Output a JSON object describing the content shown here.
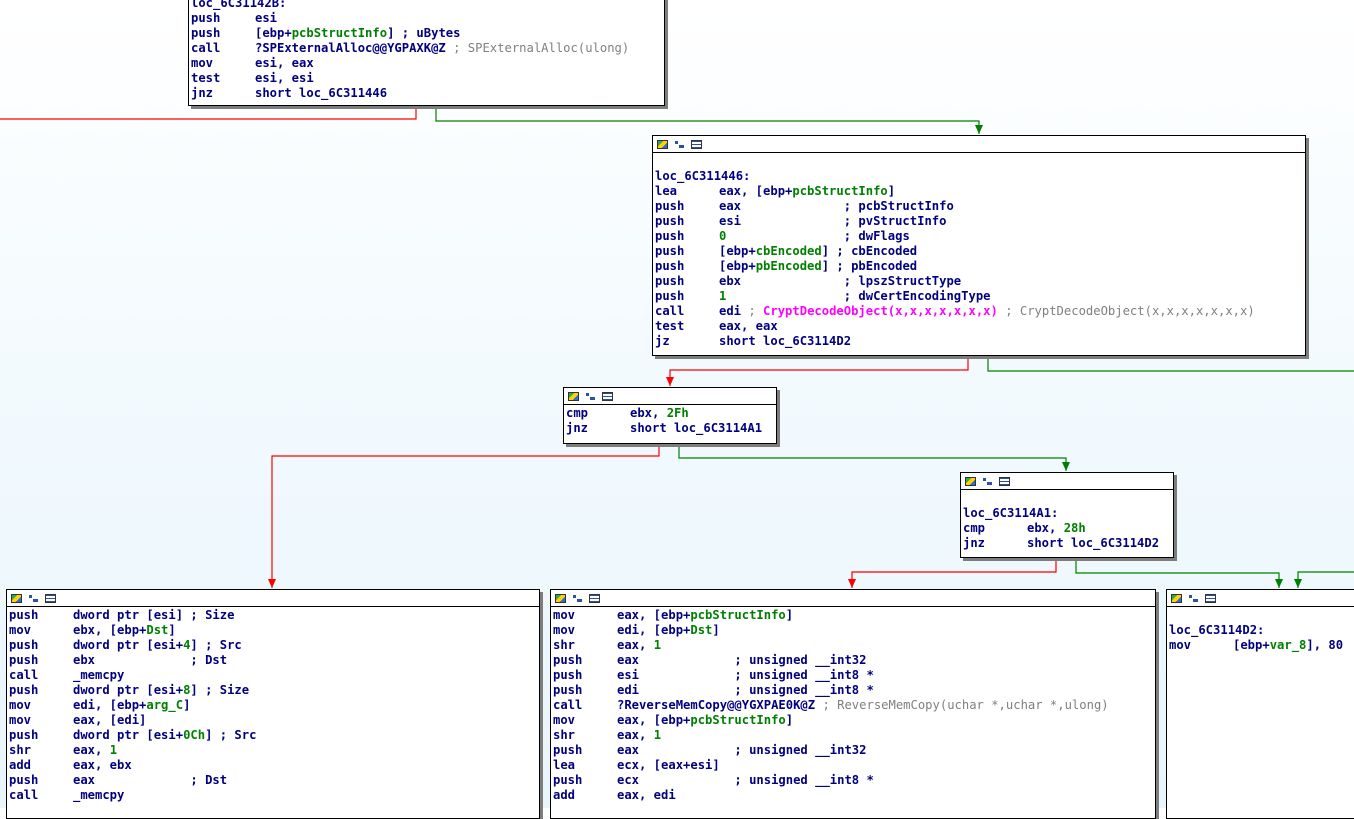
{
  "colors": {
    "false_edge": "#ff0000",
    "true_edge": "#008000",
    "unconditional_edge": "#0000ff",
    "instruction": "#000080",
    "variable": "#008000",
    "auto_comment": "#808080",
    "api_name": "#ff00ff"
  },
  "nodes": [
    {
      "id": "block-loc_6C31142B",
      "header": false,
      "lines": [
        {
          "label": "loc_6C31142B:"
        },
        {
          "mnem": "push",
          "ops": [
            {
              "t": "esi"
            }
          ]
        },
        {
          "mnem": "push",
          "ops": [
            {
              "t": "[ebp+"
            },
            {
              "t": "pcbStructInfo",
              "c": "var"
            },
            {
              "t": "] ; uBytes"
            }
          ]
        },
        {
          "mnem": "call",
          "ops": [
            {
              "t": "?SPExternalAlloc@@YGPAXK@Z"
            },
            {
              "t": " ; SPExternalAlloc(ulong)",
              "c": "ext"
            }
          ]
        },
        {
          "mnem": "mov",
          "ops": [
            {
              "t": "esi, eax"
            }
          ]
        },
        {
          "mnem": "test",
          "ops": [
            {
              "t": "esi, esi"
            }
          ]
        },
        {
          "mnem": "jnz",
          "ops": [
            {
              "t": "short loc_6C311446"
            }
          ]
        }
      ]
    },
    {
      "id": "block-loc_6C311446",
      "header": true,
      "lines": [
        {
          "blank": true
        },
        {
          "label": "loc_6C311446:"
        },
        {
          "mnem": "lea",
          "ops": [
            {
              "t": "eax, [ebp+"
            },
            {
              "t": "pcbStructInfo",
              "c": "var"
            },
            {
              "t": "]"
            }
          ]
        },
        {
          "mnem": "push",
          "ops": [
            {
              "t": "eax              ; pcbStructInfo"
            }
          ]
        },
        {
          "mnem": "push",
          "ops": [
            {
              "t": "esi              ; pvStructInfo"
            }
          ]
        },
        {
          "mnem": "push",
          "ops": [
            {
              "t": "0",
              "c": "var"
            },
            {
              "t": "                ; dwFlags"
            }
          ]
        },
        {
          "mnem": "push",
          "ops": [
            {
              "t": "[ebp+"
            },
            {
              "t": "cbEncoded",
              "c": "var"
            },
            {
              "t": "] ; cbEncoded"
            }
          ]
        },
        {
          "mnem": "push",
          "ops": [
            {
              "t": "[ebp+"
            },
            {
              "t": "pbEncoded",
              "c": "var"
            },
            {
              "t": "] ; pbEncoded"
            }
          ]
        },
        {
          "mnem": "push",
          "ops": [
            {
              "t": "ebx              ; lpszStructType"
            }
          ]
        },
        {
          "mnem": "push",
          "ops": [
            {
              "t": "1",
              "c": "var"
            },
            {
              "t": "                ; dwCertEncodingType"
            }
          ]
        },
        {
          "mnem": "call",
          "ops": [
            {
              "t": "edi "
            },
            {
              "t": "; ",
              "c": "ext"
            },
            {
              "t": "CryptDecodeObject(x,x,x,x,x,x,x)",
              "c": "magenta"
            },
            {
              "t": " ; CryptDecodeObject(x,x,x,x,x,x,x)",
              "c": "ext"
            }
          ]
        },
        {
          "mnem": "test",
          "ops": [
            {
              "t": "eax, eax"
            }
          ]
        },
        {
          "mnem": "jz",
          "ops": [
            {
              "t": "short loc_6C3114D2"
            }
          ]
        }
      ]
    },
    {
      "id": "block-cmp-2Fh",
      "header": true,
      "lines": [
        {
          "mnem": "cmp",
          "ops": [
            {
              "t": "ebx, "
            },
            {
              "t": "2Fh",
              "c": "var"
            }
          ]
        },
        {
          "mnem": "jnz",
          "ops": [
            {
              "t": "short loc_6C3114A1"
            }
          ]
        }
      ]
    },
    {
      "id": "block-loc_6C3114A1",
      "header": true,
      "lines": [
        {
          "blank": true
        },
        {
          "label": "loc_6C3114A1:"
        },
        {
          "mnem": "cmp",
          "ops": [
            {
              "t": "ebx, "
            },
            {
              "t": "28h",
              "c": "var"
            }
          ]
        },
        {
          "mnem": "jnz",
          "ops": [
            {
              "t": "short loc_6C3114D2"
            }
          ]
        }
      ]
    },
    {
      "id": "block-memcpy",
      "header": true,
      "lines": [
        {
          "mnem": "push",
          "ops": [
            {
              "t": "dword ptr [esi] ; Size"
            }
          ]
        },
        {
          "mnem": "mov",
          "ops": [
            {
              "t": "ebx, [ebp+"
            },
            {
              "t": "Dst",
              "c": "var"
            },
            {
              "t": "]"
            }
          ]
        },
        {
          "mnem": "push",
          "ops": [
            {
              "t": "dword ptr [esi+"
            },
            {
              "t": "4",
              "c": "var"
            },
            {
              "t": "] ; Src"
            }
          ]
        },
        {
          "mnem": "push",
          "ops": [
            {
              "t": "ebx             ; Dst"
            }
          ]
        },
        {
          "mnem": "call",
          "ops": [
            {
              "t": "_memcpy"
            }
          ]
        },
        {
          "mnem": "push",
          "ops": [
            {
              "t": "dword ptr [esi+"
            },
            {
              "t": "8",
              "c": "var"
            },
            {
              "t": "] ; Size"
            }
          ]
        },
        {
          "mnem": "mov",
          "ops": [
            {
              "t": "edi, [ebp+"
            },
            {
              "t": "arg_C",
              "c": "var"
            },
            {
              "t": "]"
            }
          ]
        },
        {
          "mnem": "mov",
          "ops": [
            {
              "t": "eax, [edi]"
            }
          ]
        },
        {
          "mnem": "push",
          "ops": [
            {
              "t": "dword ptr [esi+"
            },
            {
              "t": "0Ch",
              "c": "var"
            },
            {
              "t": "] ; Src"
            }
          ]
        },
        {
          "mnem": "shr",
          "ops": [
            {
              "t": "eax, "
            },
            {
              "t": "1",
              "c": "var"
            }
          ]
        },
        {
          "mnem": "add",
          "ops": [
            {
              "t": "eax, ebx"
            }
          ]
        },
        {
          "mnem": "push",
          "ops": [
            {
              "t": "eax             ; Dst"
            }
          ]
        },
        {
          "mnem": "call",
          "ops": [
            {
              "t": "_memcpy"
            }
          ]
        }
      ]
    },
    {
      "id": "block-reversememcopy",
      "header": true,
      "lines": [
        {
          "mnem": "mov",
          "ops": [
            {
              "t": "eax, [ebp+"
            },
            {
              "t": "pcbStructInfo",
              "c": "var"
            },
            {
              "t": "]"
            }
          ]
        },
        {
          "mnem": "mov",
          "ops": [
            {
              "t": "edi, [ebp+"
            },
            {
              "t": "Dst",
              "c": "var"
            },
            {
              "t": "]"
            }
          ]
        },
        {
          "mnem": "shr",
          "ops": [
            {
              "t": "eax, "
            },
            {
              "t": "1",
              "c": "var"
            }
          ]
        },
        {
          "mnem": "push",
          "ops": [
            {
              "t": "eax             ; unsigned __int32"
            }
          ]
        },
        {
          "mnem": "push",
          "ops": [
            {
              "t": "esi             ; unsigned __int8 *"
            }
          ]
        },
        {
          "mnem": "push",
          "ops": [
            {
              "t": "edi             ; unsigned __int8 *"
            }
          ]
        },
        {
          "mnem": "call",
          "ops": [
            {
              "t": "?ReverseMemCopy@@YGXPAE0K@Z"
            },
            {
              "t": " ; ReverseMemCopy(uchar *,uchar *,ulong)",
              "c": "ext"
            }
          ]
        },
        {
          "mnem": "mov",
          "ops": [
            {
              "t": "eax, [ebp+"
            },
            {
              "t": "pcbStructInfo",
              "c": "var"
            },
            {
              "t": "]"
            }
          ]
        },
        {
          "mnem": "shr",
          "ops": [
            {
              "t": "eax, "
            },
            {
              "t": "1",
              "c": "var"
            }
          ]
        },
        {
          "mnem": "push",
          "ops": [
            {
              "t": "eax             ; unsigned __int32"
            }
          ]
        },
        {
          "mnem": "lea",
          "ops": [
            {
              "t": "ecx, [eax+esi]"
            }
          ]
        },
        {
          "mnem": "push",
          "ops": [
            {
              "t": "ecx             ; unsigned __int8 *"
            }
          ]
        },
        {
          "mnem": "add",
          "ops": [
            {
              "t": "eax, edi"
            }
          ]
        }
      ]
    },
    {
      "id": "block-loc_6C3114D2",
      "header": true,
      "lines": [
        {
          "blank": true
        },
        {
          "label": "loc_6C3114D2:"
        },
        {
          "mnem": "mov",
          "ops": [
            {
              "t": "[ebp+"
            },
            {
              "t": "var_8",
              "c": "var"
            },
            {
              "t": "], 80"
            }
          ]
        }
      ]
    }
  ]
}
